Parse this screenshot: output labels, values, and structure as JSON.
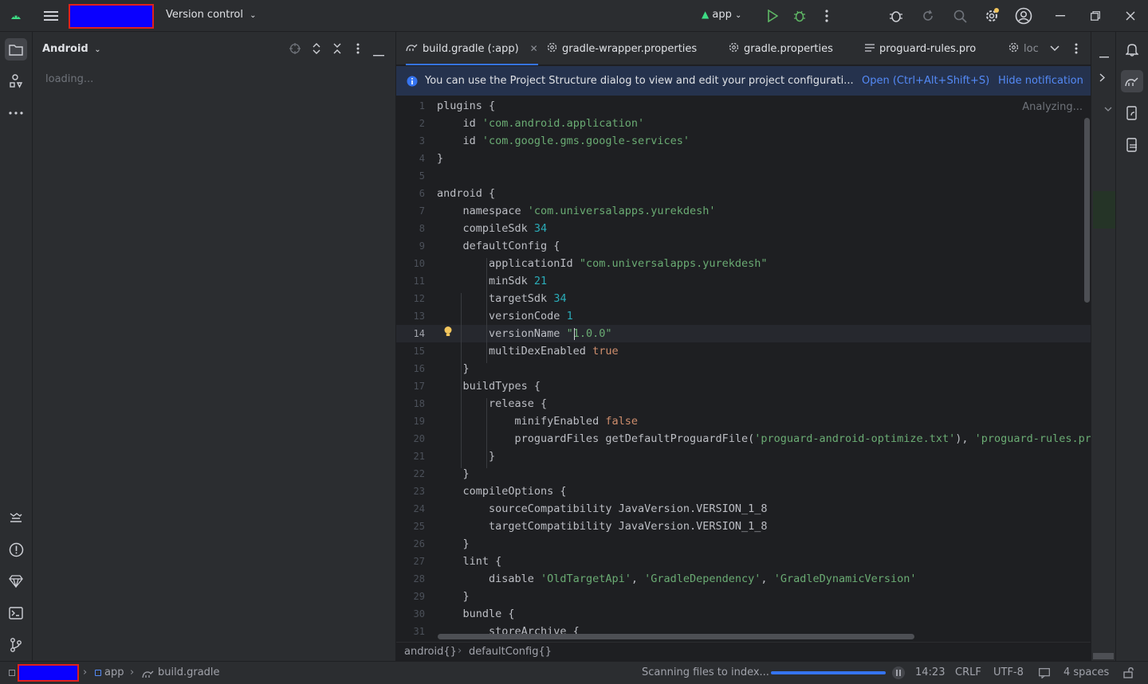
{
  "titlebar": {
    "version_control": "Version control",
    "run_config": "app",
    "colors": {
      "redaction_fill": "#0a00ff",
      "redaction_border": "#e0211d"
    }
  },
  "left_strip": {
    "icons": [
      "project-icon",
      "structure-icon",
      "more-icon",
      "resource-manager-icon",
      "problems-icon",
      "build-variants-icon",
      "terminal-icon",
      "git-icon"
    ]
  },
  "project_panel": {
    "title": "Android",
    "loading": "loading..."
  },
  "tabs": [
    {
      "label": "build.gradle (:app)",
      "active": true
    },
    {
      "label": "gradle-wrapper.properties"
    },
    {
      "label": "gradle.properties"
    },
    {
      "label": "proguard-rules.pro"
    },
    {
      "label": "loc"
    }
  ],
  "notification": {
    "text": "You can use the Project Structure dialog to view and edit your project configurati...",
    "open_link": "Open (Ctrl+Alt+Shift+S)",
    "hide_link": "Hide notification"
  },
  "editor": {
    "analyzing": "Analyzing...",
    "current_line": 14,
    "line_numbers": [
      "1",
      "2",
      "3",
      "4",
      "5",
      "6",
      "7",
      "8",
      "9",
      "10",
      "11",
      "12",
      "13",
      "14",
      "15",
      "16",
      "17",
      "18",
      "19",
      "20",
      "21",
      "22",
      "23",
      "24",
      "25",
      "26",
      "27",
      "28",
      "29",
      "30",
      "31"
    ]
  },
  "breadcrumbs": {
    "first": "android{}",
    "second": "defaultConfig{}"
  },
  "statusbar": {
    "module": "app",
    "file": "build.gradle",
    "scanning": "Scanning files to index...",
    "position": "14:23",
    "line_sep": "CRLF",
    "encoding": "UTF-8",
    "indent": "4 spaces"
  }
}
